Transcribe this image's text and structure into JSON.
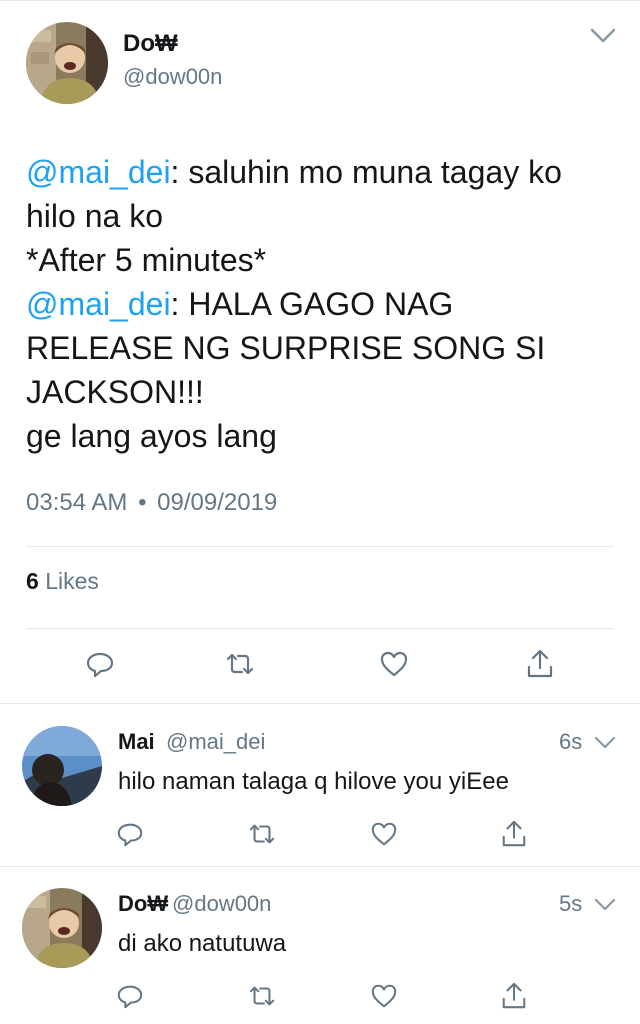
{
  "tweet": {
    "author_name": "Do₩",
    "author_handle": "@dow00n",
    "lines": [
      {
        "mention": "@mai_dei",
        "text": ": saluhin mo muna tagay ko"
      },
      {
        "mention": "",
        "text": "hilo na ko"
      },
      {
        "mention": "",
        "text": "*After 5 minutes*"
      },
      {
        "mention": "@mai_dei",
        "text": ": HALA GAGO NAG"
      },
      {
        "mention": "",
        "text": "RELEASE NG SURPRISE SONG SI"
      },
      {
        "mention": "",
        "text": "JACKSON!!!"
      },
      {
        "mention": "",
        "text": "ge lang ayos lang"
      }
    ],
    "time": "03:54 AM",
    "date": "09/09/2019",
    "likes_count": "6",
    "likes_label": "Likes",
    "separator": "•"
  },
  "replies": [
    {
      "name": "Mai",
      "handle": "@mai_dei",
      "time": "6s",
      "text": "hilo naman talaga q hilove you yiEee"
    },
    {
      "name": "Do₩",
      "handle": "@dow00n",
      "time": "5s",
      "text": "di ako natutuwa"
    }
  ],
  "icons": {
    "reply": "reply-icon",
    "retweet": "retweet-icon",
    "like": "heart-icon",
    "share": "share-icon",
    "chevron": "chevron-down-icon"
  },
  "colors": {
    "mention": "#1da1f2",
    "secondary_text": "#657786",
    "icon": "#657786",
    "divider": "#e1e8ed"
  }
}
